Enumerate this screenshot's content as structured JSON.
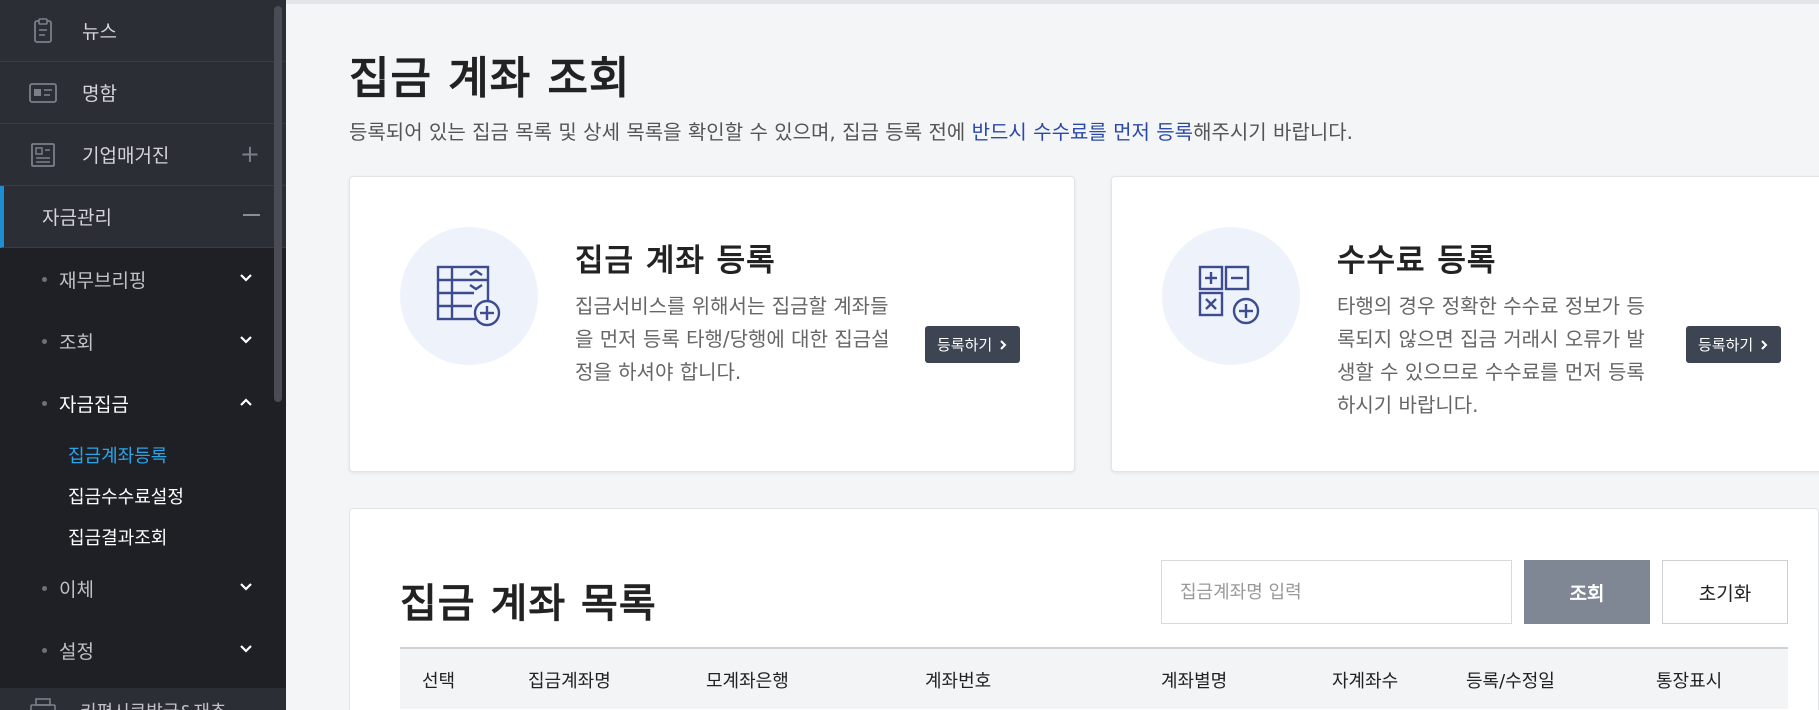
{
  "sidebar": {
    "top_items": [
      {
        "label": "뉴스",
        "icon": "clipboard-icon"
      },
      {
        "label": "명함",
        "icon": "id-card-icon"
      },
      {
        "label": "기업매거진",
        "icon": "magazine-icon",
        "expand": "+"
      }
    ],
    "section": {
      "label": "자금관리"
    },
    "sub_items": [
      {
        "label": "재무브리핑"
      },
      {
        "label": "조회"
      },
      {
        "label": "자금집금"
      },
      {
        "label": "이체"
      },
      {
        "label": "설정"
      }
    ],
    "leaves": [
      {
        "label": "집금계좌등록",
        "active": true
      },
      {
        "label": "집금수수료설정"
      },
      {
        "label": "집금결과조회"
      }
    ],
    "bottom_item": {
      "label": "키평시큐발급&재추",
      "icon": "printer-icon"
    }
  },
  "page": {
    "title": "집금 계좌 조회",
    "desc_before": "등록되어 있는 집금 목록 및 상세 목록을 확인할 수 있으며, 집금 등록 전에 ",
    "desc_highlight": "반드시 수수료를 먼저 등록",
    "desc_after": "해주시기 바랍니다."
  },
  "cards": [
    {
      "title": "집금 계좌 등록",
      "desc": "집금서비스를 위해서는 집금할 계좌들을 먼저 등록 타행/당행에 대한 집금설정을 하셔야 합니다.",
      "button": "등록하기",
      "icon": "table-add-icon"
    },
    {
      "title": "수수료 등록",
      "desc": "타행의 경우 정확한 수수료 정보가 등록되지 않으면 집금 거래시 오류가 발생할 수 있으므로 수수료를 먼저 등록하시기 바랍니다.",
      "button": "등록하기",
      "icon": "calculator-add-icon"
    }
  ],
  "list": {
    "title": "집금 계좌 목록",
    "search_placeholder": "집금계좌명 입력",
    "search_button": "조회",
    "reset_button": "초기화",
    "columns": [
      "선택",
      "집금계좌명",
      "모계좌은행",
      "계좌번호",
      "계좌별명",
      "자계좌수",
      "등록/수정일",
      "통장표시"
    ]
  },
  "colors": {
    "sidebar_bg": "#1f2026",
    "accent": "#1c8fd4",
    "link": "#2b4aa8",
    "button_dark": "#3d4452"
  }
}
